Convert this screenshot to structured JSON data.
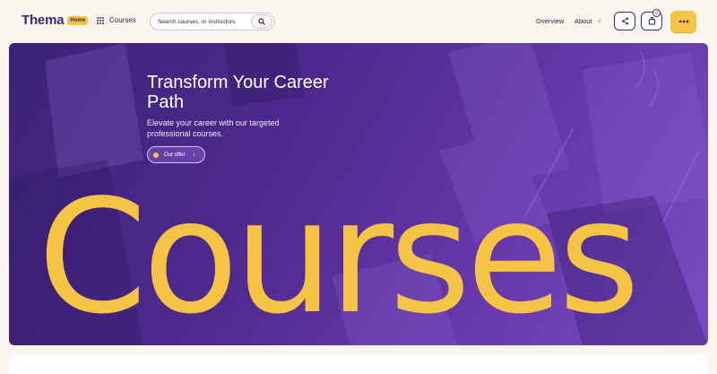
{
  "header": {
    "brand": "Thema",
    "badge": "Home",
    "courses_label": "Courses",
    "search_placeholder": "Search courses, or instructors",
    "nav": {
      "overview": "Overview",
      "about": "About"
    },
    "cart_count": "0"
  },
  "hero": {
    "title": "Transform Your Career Path",
    "subtitle": "Elevate your career with our targeted professional courses.",
    "offer_label": "Our offer",
    "big_word": "Courses"
  },
  "colors": {
    "accent": "#f5c445",
    "brand": "#3a2a6e",
    "hero": "#4f2a8f"
  }
}
